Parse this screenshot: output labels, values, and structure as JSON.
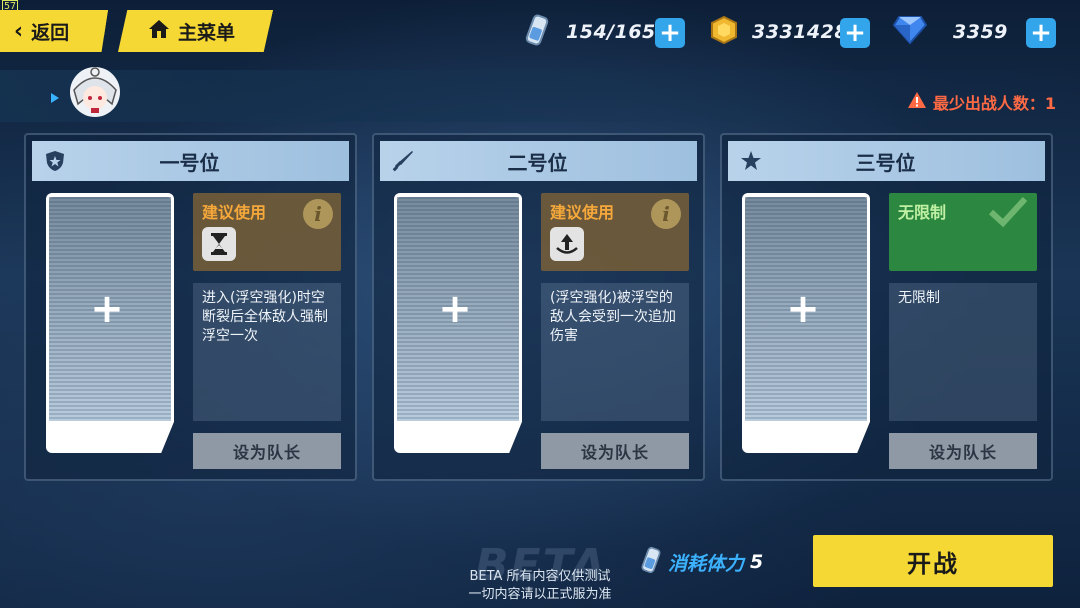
{
  "fps": "57",
  "nav": {
    "back_label": "返回",
    "menu_label": "主菜单"
  },
  "resources": {
    "stamina": {
      "icon": "stamina-bottle-icon",
      "value": "154/165"
    },
    "coins": {
      "icon": "coin-icon",
      "value": "33314287"
    },
    "crystals": {
      "icon": "crystal-icon",
      "value": "3359"
    }
  },
  "warning": {
    "text": "最少出战人数：1",
    "color": "#ff6a45"
  },
  "slots": [
    {
      "title": "一号位",
      "header_icon": "shield-icon",
      "rec_label": "建议使用",
      "rec_kind": "suggest",
      "rec_icon": "hourglass-icon",
      "desc": "进入(浮空强化)时空断裂后全体敌人强制浮空一次",
      "leader_label": "设为队长"
    },
    {
      "title": "二号位",
      "header_icon": "sword-icon",
      "rec_label": "建议使用",
      "rec_kind": "suggest",
      "rec_icon": "launch-up-icon",
      "desc": "(浮空强化)被浮空的敌人会受到一次追加伤害",
      "leader_label": "设为队长"
    },
    {
      "title": "三号位",
      "header_icon": "star-icon",
      "rec_label": "无限制",
      "rec_kind": "free",
      "rec_icon": "check-icon",
      "desc": "无限制",
      "leader_label": "设为队长"
    }
  ],
  "footer": {
    "cost_label": "消耗体力",
    "cost_value": "5",
    "start_label": "开战",
    "beta_watermark": "BETA",
    "beta_note_line1": "BETA 所有内容仅供测试",
    "beta_note_line2": "一切内容请以正式服为准"
  },
  "colors": {
    "accent": "#f5d833",
    "plus": "#33a5ea",
    "suggest": "#f6a83a",
    "free": "#2c8840"
  }
}
